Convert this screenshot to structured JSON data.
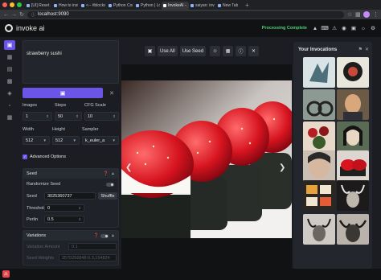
{
  "browser": {
    "tabs": [
      {
        "label": "[UI] Reset / A"
      },
      {
        "label": "How to instal"
      },
      {
        "label": "<-- #blocks"
      },
      {
        "label": "Python Com"
      },
      {
        "label": "Python | Lo"
      },
      {
        "label": "InvokeAI - A S",
        "active": true
      },
      {
        "label": "saiyan: invoke"
      },
      {
        "label": "New Tab"
      }
    ],
    "new_tab": "+",
    "url": "localhost:9090"
  },
  "app": {
    "brand": "invoke ai",
    "status": "Processing Complete",
    "accent": "#6b55e6",
    "status_color": "#4ecf77"
  },
  "prompt": {
    "value": "strawberry sushi"
  },
  "params": {
    "images_label": "Images",
    "images": "1",
    "steps_label": "Steps",
    "steps": "50",
    "cfg_label": "CFG Scale",
    "cfg": "10",
    "width_label": "Width",
    "width": "512",
    "height_label": "Height",
    "height": "512",
    "sampler_label": "Sampler",
    "sampler": "k_euler_a"
  },
  "advanced": {
    "label": "Advanced Options",
    "checked": true
  },
  "seed_panel": {
    "title": "Seed",
    "randomize_label": "Randomize Seed",
    "seed_label": "Seed",
    "seed": "3025360737",
    "shuffle": "Shuffle",
    "threshold_label": "Threshold",
    "threshold": "0",
    "perlin_label": "Perlin",
    "perlin": "0.5"
  },
  "variations_panel": {
    "title": "Variations",
    "amount_label": "Variation Amount",
    "amount": "0.1",
    "weights_label": "Seed Weights",
    "weights": "2570256848:0.3,154824"
  },
  "toolbar": {
    "use_all": "Use All",
    "use_seed": "Use Seed"
  },
  "invocations": {
    "title": "Your Invocations"
  }
}
